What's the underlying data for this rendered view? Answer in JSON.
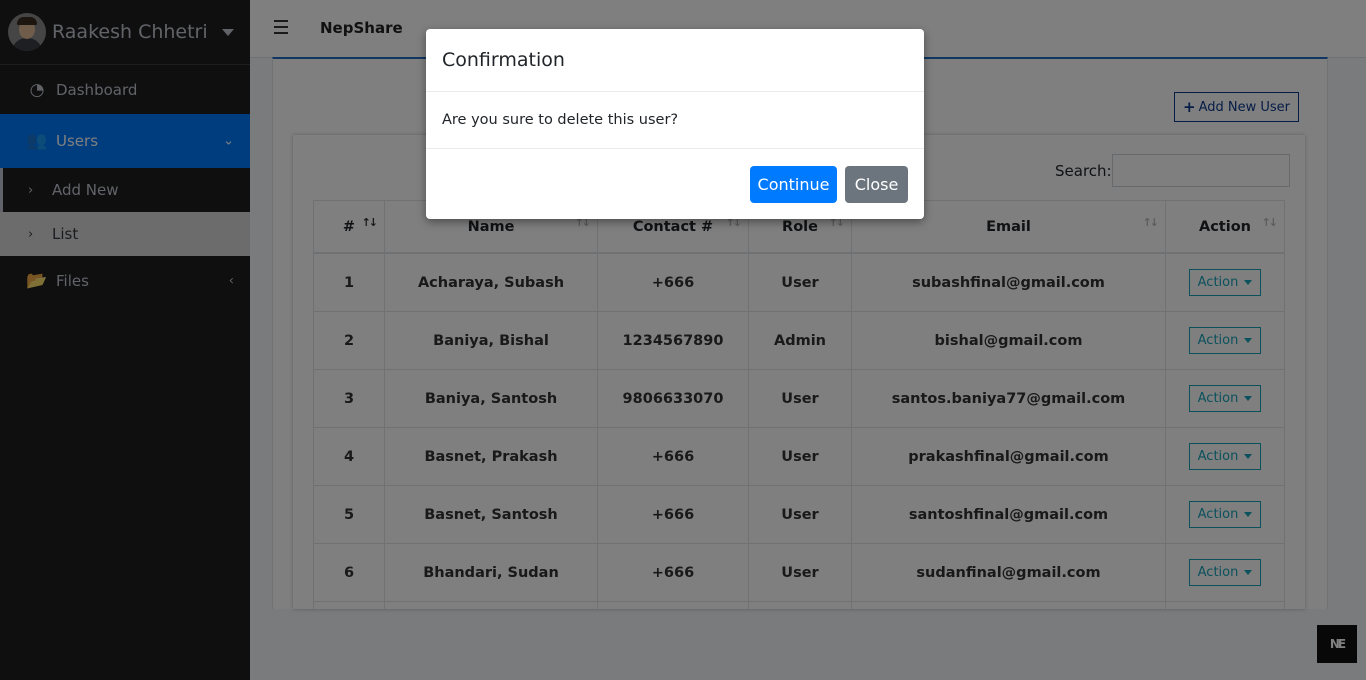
{
  "user": {
    "name": "Raakesh Chhetri"
  },
  "sidebar": {
    "items": [
      {
        "label": "Dashboard",
        "icon": "dashboard-gauge-icon"
      },
      {
        "label": "Users",
        "icon": "users-icon"
      },
      {
        "label": "Files",
        "icon": "folder-open-icon"
      }
    ],
    "users_sub": [
      {
        "label": "Add New"
      },
      {
        "label": "List"
      }
    ]
  },
  "header": {
    "brand": "NepShare"
  },
  "toolbar": {
    "add_user_label": "Add New User"
  },
  "search": {
    "label": "Search:",
    "value": ""
  },
  "table": {
    "headers": [
      "#",
      "Name",
      "Contact #",
      "Role",
      "Email",
      "Action"
    ],
    "rows": [
      {
        "no": "1",
        "name": "Acharaya, Subash",
        "contact": "+666",
        "role": "User",
        "email": "subashfinal@gmail.com",
        "action": "Action"
      },
      {
        "no": "2",
        "name": "Baniya, Bishal",
        "contact": "1234567890",
        "role": "Admin",
        "email": "bishal@gmail.com",
        "action": "Action"
      },
      {
        "no": "3",
        "name": "Baniya, Santosh",
        "contact": "9806633070",
        "role": "User",
        "email": "santos.baniya77@gmail.com",
        "action": "Action"
      },
      {
        "no": "4",
        "name": "Basnet, Prakash",
        "contact": "+666",
        "role": "User",
        "email": "prakashfinal@gmail.com",
        "action": "Action"
      },
      {
        "no": "5",
        "name": "Basnet, Santosh",
        "contact": "+666",
        "role": "User",
        "email": "santoshfinal@gmail.com",
        "action": "Action"
      },
      {
        "no": "6",
        "name": "Bhandari, Sudan",
        "contact": "+666",
        "role": "User",
        "email": "sudanfinal@gmail.com",
        "action": "Action"
      }
    ]
  },
  "modal": {
    "title": "Confirmation",
    "message": "Are you sure to delete this user?",
    "continue_label": "Continue",
    "close_label": "Close"
  },
  "corner_badge": {
    "text": "NE"
  },
  "colors": {
    "primary": "#007bff",
    "sidebar_bg": "#1e1f21",
    "info": "#17a2b8",
    "secondary": "#6c757d"
  }
}
